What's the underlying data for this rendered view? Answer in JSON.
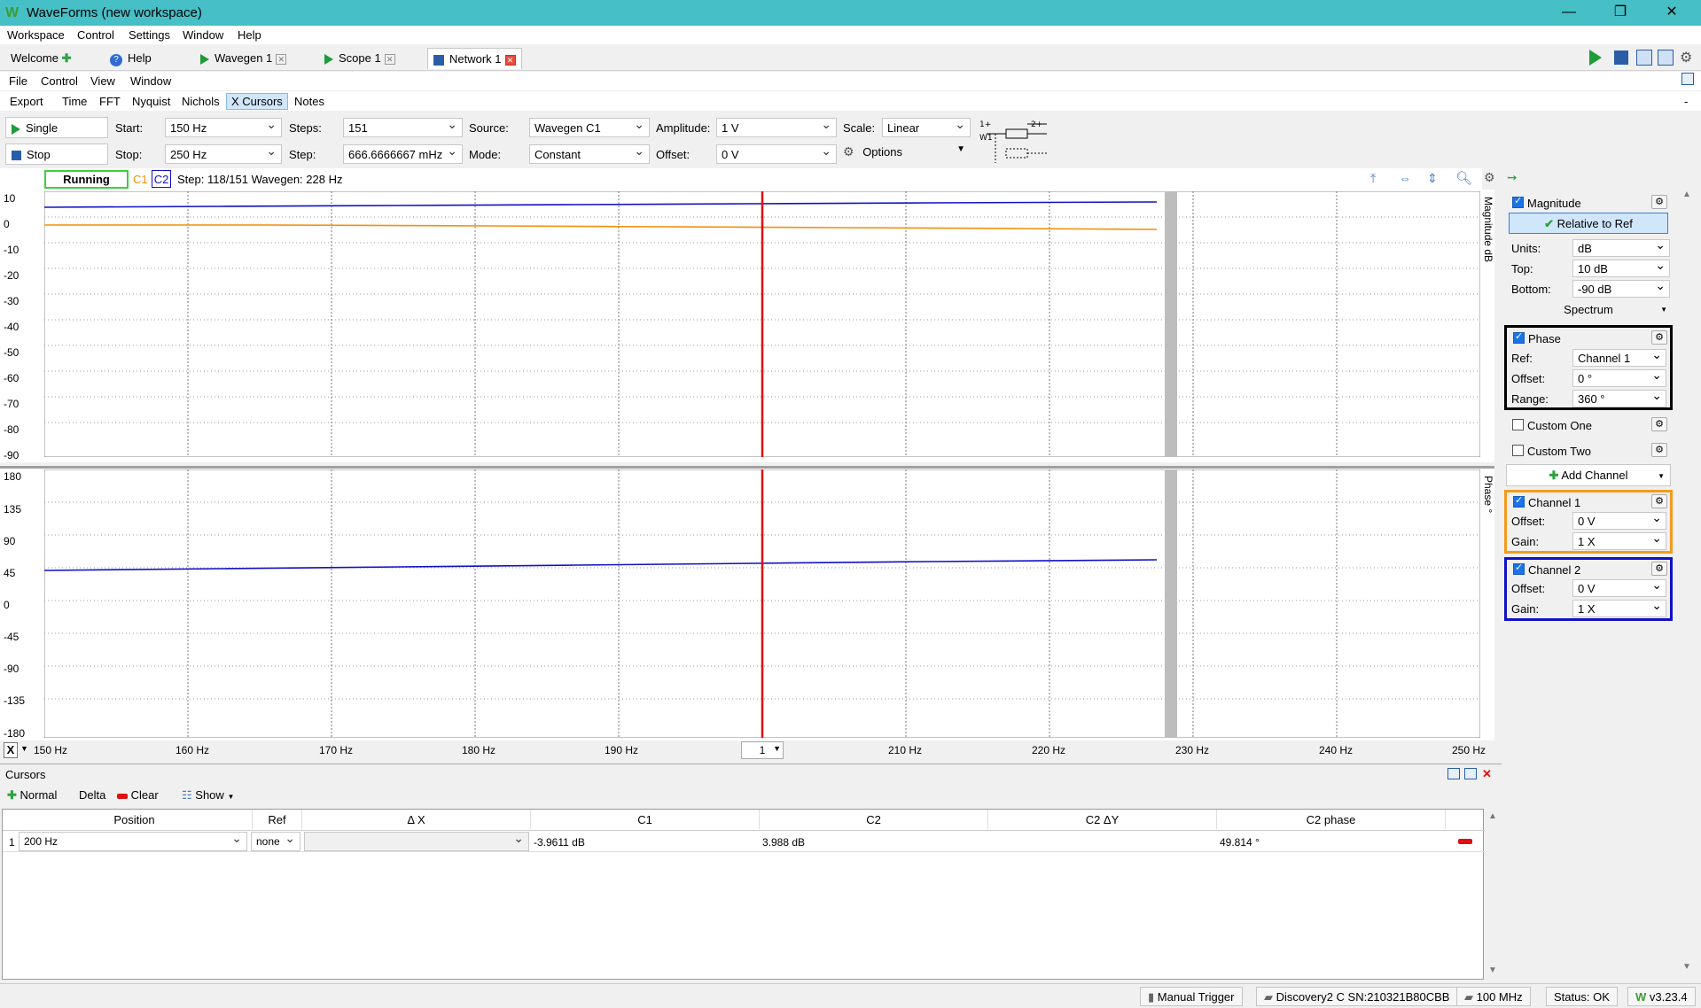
{
  "app": {
    "title": "WaveForms (new workspace)"
  },
  "menu": [
    "Workspace",
    "Control",
    "Settings",
    "Window",
    "Help"
  ],
  "tabs": [
    {
      "label": "Welcome"
    },
    {
      "label": "Help"
    },
    {
      "label": "Wavegen 1"
    },
    {
      "label": "Scope 1"
    },
    {
      "label": "Network 1"
    }
  ],
  "submenu": [
    "File",
    "Control",
    "View",
    "Window"
  ],
  "views": [
    "Export",
    "Time",
    "FFT",
    "Nyquist",
    "Nichols",
    "X Cursors",
    "Notes"
  ],
  "controls": {
    "single": "Single",
    "stop": "Stop",
    "start_label": "Start:",
    "start": "150 Hz",
    "stop_label": "Stop:",
    "stop_val": "250 Hz",
    "steps_label": "Steps:",
    "steps": "151",
    "step_label": "Step:",
    "step": "666.6666667 mHz",
    "source_label": "Source:",
    "source": "Wavegen C1",
    "mode_label": "Mode:",
    "mode": "Constant",
    "amplitude_label": "Amplitude:",
    "amplitude": "1 V",
    "offset_label": "Offset:",
    "offset": "0 V",
    "scale_label": "Scale:",
    "scale": "Linear",
    "options": "Options"
  },
  "status": {
    "running": "Running",
    "c1": "C1",
    "c2": "C2",
    "text": "Step: 118/151  Wavegen: 228 Hz"
  },
  "plot": {
    "mag_ticks": [
      "10",
      "0",
      "-10",
      "-20",
      "-30",
      "-40",
      "-50",
      "-60",
      "-70",
      "-80",
      "-90"
    ],
    "phase_ticks": [
      "180",
      "135",
      "90",
      "45",
      "0",
      "-45",
      "-90",
      "-135",
      "-180"
    ],
    "x_ticks": [
      "150 Hz",
      "160 Hz",
      "170 Hz",
      "180 Hz",
      "190 Hz",
      "210 Hz",
      "220 Hz",
      "230 Hz",
      "240 Hz",
      "250 Hz"
    ],
    "mag_axis_label": "Magnitude  dB",
    "phase_axis_label": "Phase  °",
    "cursor_index": "1",
    "x_label": "X",
    "colors": {
      "c1": "#f0900c",
      "c2": "#1010c8",
      "cursor": "#e01010"
    }
  },
  "right": {
    "magnitude": "Magnitude",
    "relative": "Relative to Ref",
    "units_label": "Units:",
    "units": "dB",
    "top_label": "Top:",
    "top": "10 dB",
    "bottom_label": "Bottom:",
    "bottom": "-90 dB",
    "spectrum": "Spectrum",
    "phase": "Phase",
    "ref_label": "Ref:",
    "ref": "Channel 1",
    "poffset_label": "Offset:",
    "poffset": "0 °",
    "range_label": "Range:",
    "range": "360 °",
    "custom_one": "Custom One",
    "custom_two": "Custom Two",
    "add_channel": "Add Channel",
    "ch1": "Channel 1",
    "ch1_offset_label": "Offset:",
    "ch1_offset": "0 V",
    "ch1_gain_label": "Gain:",
    "ch1_gain": "1 X",
    "ch2": "Channel 2",
    "ch2_offset_label": "Offset:",
    "ch2_offset": "0 V",
    "ch2_gain_label": "Gain:",
    "ch2_gain": "1 X"
  },
  "cursors": {
    "title": "Cursors",
    "normal": "Normal",
    "delta": "Delta",
    "clear": "Clear",
    "show": "Show",
    "headers": [
      "Position",
      "Ref",
      "Δ X",
      "C1",
      "C2",
      "C2 ΔY",
      "C2 phase"
    ],
    "rows": [
      {
        "num": "1",
        "position": "200 Hz",
        "ref": "none",
        "dx": "",
        "c1": "-3.9611 dB",
        "c2": "3.988 dB",
        "c2dy": "",
        "c2phase": "49.814 °"
      }
    ]
  },
  "statusbar": {
    "trigger": "Manual Trigger",
    "device": "Discovery2 C SN:210321B80CBB",
    "freq": "100 MHz",
    "status": "Status: OK",
    "version": "v3.23.4"
  }
}
